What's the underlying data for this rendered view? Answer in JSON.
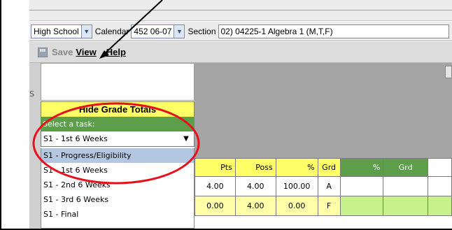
{
  "filters": {
    "school_value": "High School",
    "calendar_label": "Calendar",
    "calendar_value": "452 06-07",
    "section_label": "Section",
    "section_value": "02) 04225-1 Algebra 1 (M,T,F)"
  },
  "menu": {
    "save": "Save",
    "view": "View",
    "help": "Help"
  },
  "left_fragment": "S",
  "panel": {
    "hide_totals": "Hide Grade Totals",
    "task_header": "Select a task:",
    "task_selected": "S1 - 1st 6 Weeks",
    "task_options": [
      "S1 - Progress/Eligibility",
      "S1 - 1st 6 Weeks",
      "S1 - 2nd 6 Weeks",
      "S1 - 3rd 6 Weeks",
      "S1 - Final"
    ]
  },
  "grid": {
    "headers": [
      "Pts",
      "Poss",
      "%",
      "Grd",
      "%",
      "Grd"
    ],
    "rows": [
      [
        "4.00",
        "4.00",
        "100.00",
        "A",
        "",
        ""
      ],
      [
        "0.00",
        "4.00",
        "0.00",
        "F",
        "",
        ""
      ]
    ]
  },
  "colors": {
    "hide_totals_bg": "#ffff66",
    "task_header_bg": "#5c9e4a",
    "highlight_row": "#b3c7e0",
    "annotation_red": "#e8101a"
  },
  "icons": {
    "save": "save-icon",
    "dropdown": "chevron-down-icon",
    "annotation_arrow": "arrow-icon"
  }
}
